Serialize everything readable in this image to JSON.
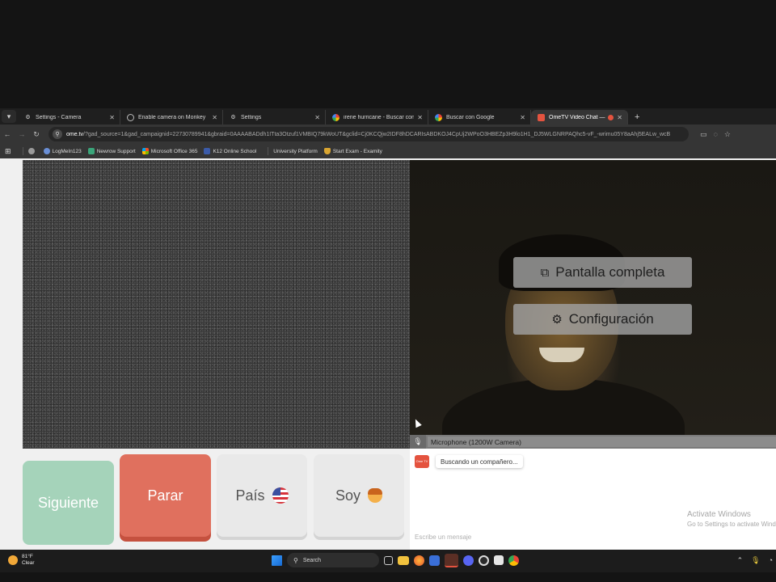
{
  "browser": {
    "tabs": [
      {
        "title": "Settings - Camera",
        "icon": "gear-icon",
        "active": false
      },
      {
        "title": "Enable camera on Monkey",
        "icon": "globe-icon",
        "active": false
      },
      {
        "title": "Settings",
        "icon": "gear-icon",
        "active": false
      },
      {
        "title": "irene hurricane - Buscar con Go",
        "icon": "google-icon",
        "active": false
      },
      {
        "title": "Buscar con Google",
        "icon": "google-icon",
        "active": false
      },
      {
        "title": "OmeTV Video Chat — Ome",
        "icon": "ometv-icon",
        "active": true
      }
    ],
    "url_host": "ome.tv",
    "url_rest": "/?gad_source=1&gad_campaignid=22730789941&gbraid=0AAAABADdh1ITta3Otzuf1VMBIQ79kWoUT&gclid=Cj0KCQjw2IDF8hDCARIsABDKOJ4CpUj2WPoO3HBEZp3H9lo1H1_DJ5WLGNRPAQhc5-vF_-wrimu05Y8aAhj5EALw_wcB",
    "bookmarks": [
      "LogMeIn123",
      "Newrow Support",
      "Microsoft Office 365",
      "K12 Online School",
      "University Platform",
      "Start Exam - Examity"
    ]
  },
  "video": {
    "fullscreen_label": "Pantalla completa",
    "settings_label": "Configuración",
    "mic_label": "Microphone (1200W Camera)"
  },
  "controls": {
    "next_label": "Siguiente",
    "stop_label": "Parar",
    "country_label": "País",
    "gender_label": "Soy"
  },
  "chat": {
    "logo_text": "Ome TV",
    "status_message": "Buscando un compañero...",
    "input_placeholder": "Escribe un mensaje",
    "activate_title": "Activate Windows",
    "activate_sub": "Go to Settings to activate Windo"
  },
  "taskbar": {
    "temperature": "81°F",
    "condition": "Clear",
    "search_label": "Search"
  },
  "colors": {
    "next_button": "#a5d3ba",
    "stop_button": "#e0705e",
    "neutral_button": "#e9e9e9"
  }
}
